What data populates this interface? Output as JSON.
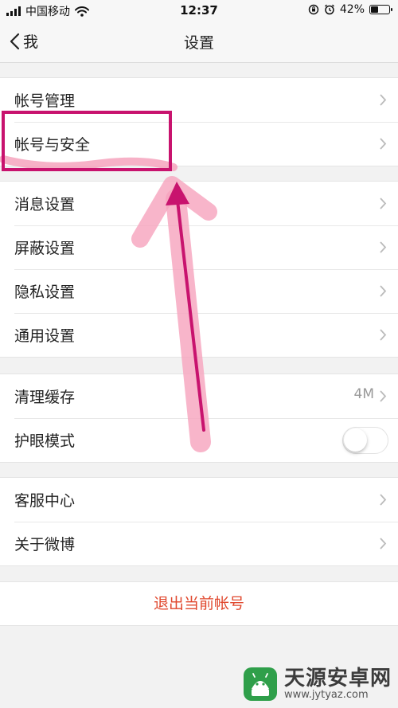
{
  "status_bar": {
    "carrier": "中国移动",
    "time": "12:37",
    "battery_percent": "42%",
    "battery_level": 0.42
  },
  "nav": {
    "back_label": "我",
    "title": "设置"
  },
  "groups": [
    {
      "items": [
        {
          "label": "帐号管理"
        },
        {
          "label": "帐号与安全"
        }
      ]
    },
    {
      "items": [
        {
          "label": "消息设置"
        },
        {
          "label": "屏蔽设置"
        },
        {
          "label": "隐私设置"
        },
        {
          "label": "通用设置"
        }
      ]
    },
    {
      "items": [
        {
          "label": "清理缓存",
          "value": "4M"
        },
        {
          "label": "护眼模式",
          "toggle": false
        }
      ]
    },
    {
      "items": [
        {
          "label": "客服中心"
        },
        {
          "label": "关于微博"
        }
      ]
    }
  ],
  "logout_label": "退出当前帐号",
  "colors": {
    "logout": "#e0482e",
    "annotation": "#c8136e",
    "highlight": "#f6a3bd"
  },
  "watermark": {
    "title": "天源安卓网",
    "url": "www.jytyaz.com"
  }
}
